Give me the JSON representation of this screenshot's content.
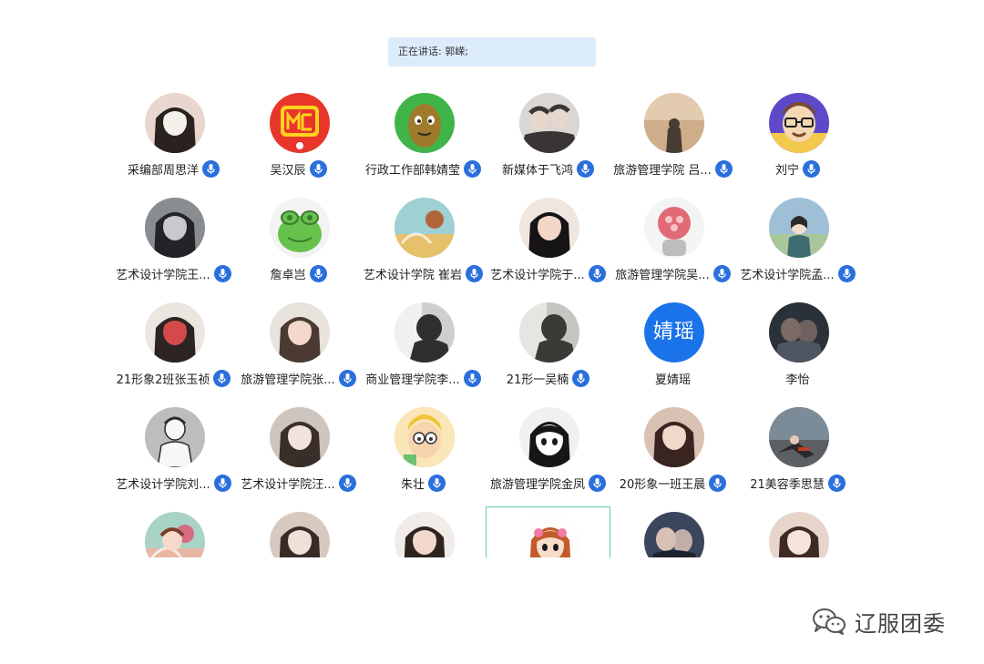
{
  "speaking": {
    "label": "正在讲话: 郭嵘;"
  },
  "participants": [
    {
      "name": "采编部周思洋",
      "mic": true,
      "avatar": "photo-girl-icon",
      "bg": "#e9d6cf",
      "fg": "#2b2220",
      "accent": "#f3efe9"
    },
    {
      "name": "吴汉辰",
      "mic": true,
      "avatar": "mc-logo-icon",
      "bg": "#e8362a",
      "fg": "#ffd21f",
      "accent": "#e8362a"
    },
    {
      "name": "行政工作部韩婧莹",
      "mic": true,
      "avatar": "cartoon-nut-icon",
      "bg": "#3fb549",
      "fg": "#a07a2c",
      "accent": "#2e2a1c"
    },
    {
      "name": "新媒体于飞鸿",
      "mic": true,
      "avatar": "photo-people-icon",
      "bg": "#d9d6d4",
      "fg": "#3a3434",
      "accent": "#b9b3ad"
    },
    {
      "name": "旅游管理学院 吕...",
      "mic": true,
      "avatar": "photo-beach-icon",
      "bg": "#cfae8c",
      "fg": "#473c33",
      "accent": "#e3cbb0"
    },
    {
      "name": "刘宁",
      "mic": true,
      "avatar": "cartoon-glasses-icon",
      "bg": "#5e49c9",
      "fg": "#f0c24a",
      "accent": "#1e1e1e"
    },
    {
      "name": "艺术设计学院王...",
      "mic": true,
      "avatar": "photo-boy-icon",
      "bg": "#8a8d90",
      "fg": "#222428",
      "accent": "#c8c9cb"
    },
    {
      "name": "詹卓岂",
      "mic": true,
      "avatar": "cartoon-frog-icon",
      "bg": "#f3f3f3",
      "fg": "#67c24d",
      "accent": "#3b7a2d"
    },
    {
      "name": "艺术设计学院 崔岩",
      "mic": true,
      "avatar": "painting-icon",
      "bg": "#9ed0d4",
      "fg": "#e6c06a",
      "accent": "#b0663a"
    },
    {
      "name": "艺术设计学院于...",
      "mic": true,
      "avatar": "photo-girl-icon",
      "bg": "#efe6df",
      "fg": "#161414",
      "accent": "#f2d6c8"
    },
    {
      "name": "旅游管理学院吴...",
      "mic": true,
      "avatar": "astronaut-icon",
      "bg": "#f4f4f4",
      "fg": "#e06b77",
      "accent": "#bdbdbd"
    },
    {
      "name": "艺术设计学院孟...",
      "mic": true,
      "avatar": "photo-field-icon",
      "bg": "#9fbfd6",
      "fg": "#3e6b70",
      "accent": "#a9c79a"
    },
    {
      "name": "21形象2班张玉祯",
      "mic": true,
      "avatar": "photo-girl-icon",
      "bg": "#ece6e0",
      "fg": "#2c2422",
      "accent": "#d44a4a"
    },
    {
      "name": "旅游管理学院张...",
      "mic": true,
      "avatar": "photo-child-icon",
      "bg": "#e9e3de",
      "fg": "#4a3a32",
      "accent": "#f4d8cc"
    },
    {
      "name": "商业管理学院李...",
      "mic": true,
      "avatar": "photo-hand-icon",
      "bg": "#cfcfcf",
      "fg": "#2f2f2f",
      "accent": "#f0f0f0"
    },
    {
      "name": "21形一吴楠",
      "mic": true,
      "avatar": "photo-mirror-icon",
      "bg": "#c7c5c1",
      "fg": "#3b3a37",
      "accent": "#e7e5e1"
    },
    {
      "name": "夏婧瑶",
      "mic": false,
      "avatar": "text-avatar",
      "avatar_text": "婧瑶",
      "bg": "#1a73e8",
      "fg": "#ffffff",
      "accent": "#1a73e8"
    },
    {
      "name": "李怡",
      "mic": false,
      "avatar": "photo-couple-icon",
      "bg": "#2b3139",
      "fg": "#7b6a66",
      "accent": "#4f5661"
    },
    {
      "name": "艺术设计学院刘...",
      "mic": true,
      "avatar": "sketch-boy-icon",
      "bg": "#bdbdbd",
      "fg": "#f7f7f7",
      "accent": "#2a2a2a"
    },
    {
      "name": "艺术设计学院汪...",
      "mic": true,
      "avatar": "photo-girl-icon",
      "bg": "#cfc5bf",
      "fg": "#3a2e2a",
      "accent": "#efe3dc"
    },
    {
      "name": "朱壮",
      "mic": true,
      "avatar": "cartoon-boy-icon",
      "bg": "#e9a36a",
      "fg": "#5a3a22",
      "accent": "#fbe6b7"
    },
    {
      "name": "旅游管理学院金凤",
      "mic": true,
      "avatar": "anime-girl-icon",
      "bg": "#f0f0f0",
      "fg": "#161616",
      "accent": "#ffffff"
    },
    {
      "name": "20形象一班王晨",
      "mic": true,
      "avatar": "photo-girl-icon",
      "bg": "#d9c2b4",
      "fg": "#3a2420",
      "accent": "#f1d8cb"
    },
    {
      "name": "21美容季思慧",
      "mic": true,
      "avatar": "photo-street-icon",
      "bg": "#7b8c98",
      "fg": "#2a2a2a",
      "accent": "#c23a2a"
    },
    {
      "name": "",
      "mic": false,
      "avatar": "painting-girl-icon",
      "bg": "#a9d3c7",
      "fg": "#e7b7a3",
      "accent": "#d66b82"
    },
    {
      "name": "",
      "mic": false,
      "avatar": "photo-girl-icon",
      "bg": "#d7c9c0",
      "fg": "#3a2a26",
      "accent": "#efe1d8"
    },
    {
      "name": "",
      "mic": false,
      "avatar": "photo-girl-icon",
      "bg": "#f2ece8",
      "fg": "#2e2420",
      "accent": "#f1d8cb"
    },
    {
      "name": "",
      "mic": false,
      "avatar": "cartoon-girl-icon",
      "bg": "#fdfdfd",
      "fg": "#f07aa8",
      "accent": "#3b78d8",
      "selected": true
    },
    {
      "name": "",
      "mic": false,
      "avatar": "photo-couple-icon",
      "bg": "#39465c",
      "fg": "#d8c1b4",
      "accent": "#1c2230"
    },
    {
      "name": "",
      "mic": false,
      "avatar": "photo-girl-icon",
      "bg": "#e7d4cb",
      "fg": "#3d2a24",
      "accent": "#f4e4dc"
    }
  ],
  "watermark": {
    "text": "辽服团委",
    "icon": "wechat-icon"
  }
}
